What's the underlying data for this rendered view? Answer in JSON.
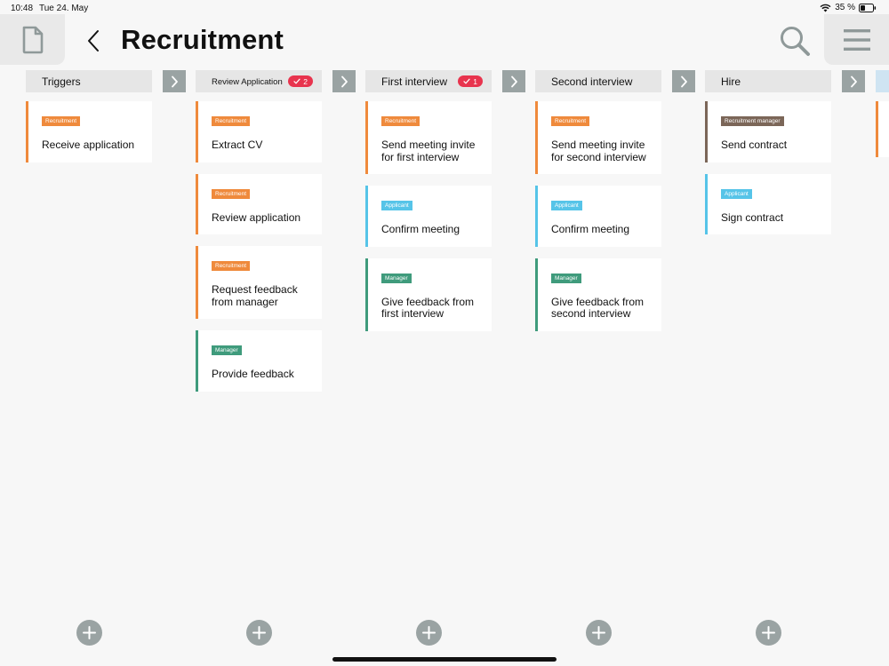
{
  "status": {
    "time": "10:48",
    "date": "Tue 24. May",
    "battery": "35 %"
  },
  "header": {
    "title": "Recruitment",
    "left_icon": "document-icon",
    "back_icon": "chevron-left-icon",
    "search_icon": "search-icon",
    "menu_icon": "hamburger-icon"
  },
  "colors": {
    "Recruitment": "#ef8a3c",
    "Applicant": "#56c4e8",
    "Manager": "#3f9b7c",
    "Recruitment manager": "#7b6658",
    "badge": "#e8344e",
    "connector": "#9aa3a3"
  },
  "columns": [
    {
      "title": "Triggers",
      "badge": null,
      "cards": [
        {
          "tag": "Recruitment",
          "text": "Receive application"
        }
      ]
    },
    {
      "title": "Review Application",
      "badge": "2",
      "cards": [
        {
          "tag": "Recruitment",
          "text": "Extract CV"
        },
        {
          "tag": "Recruitment",
          "text": "Review application"
        },
        {
          "tag": "Recruitment",
          "text": "Request feedback\nfrom manager"
        },
        {
          "tag": "Manager",
          "text": "Provide feedback"
        }
      ]
    },
    {
      "title": "First interview",
      "badge": "1",
      "cards": [
        {
          "tag": "Recruitment",
          "text": "Send meeting invite\nfor first interview"
        },
        {
          "tag": "Applicant",
          "text": "Confirm meeting"
        },
        {
          "tag": "Manager",
          "text": "Give feedback from\nfirst interview"
        }
      ]
    },
    {
      "title": "Second interview",
      "badge": null,
      "cards": [
        {
          "tag": "Recruitment",
          "text": "Send meeting invite\nfor second interview"
        },
        {
          "tag": "Applicant",
          "text": "Confirm meeting"
        },
        {
          "tag": "Manager",
          "text": "Give feedback from\nsecond interview"
        }
      ]
    },
    {
      "title": "Hire",
      "badge": null,
      "cards": [
        {
          "tag": "Recruitment manager",
          "text": "Send contract"
        },
        {
          "tag": "Applicant",
          "text": "Sign contract"
        }
      ]
    }
  ]
}
